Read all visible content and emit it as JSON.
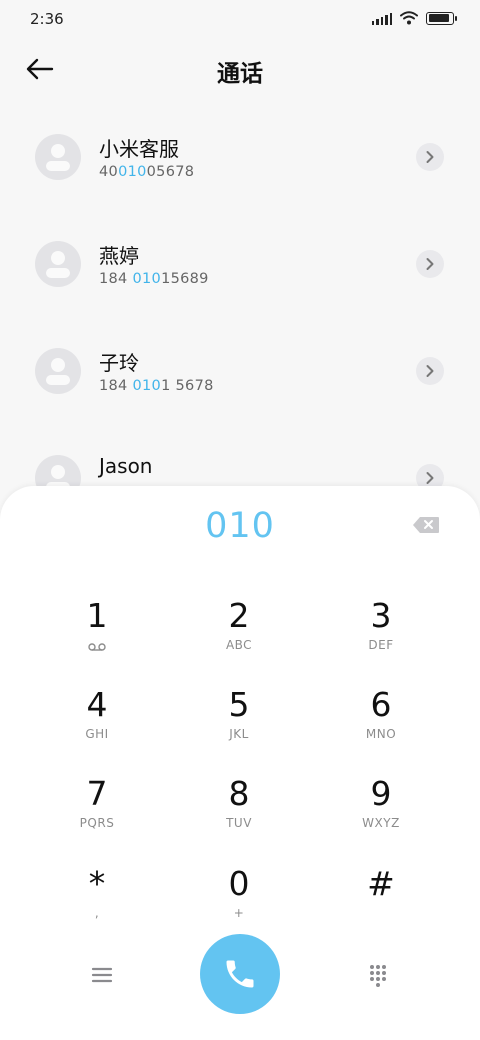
{
  "status_bar": {
    "time": "2:36",
    "battery_level": 0.9,
    "icons": [
      "signal-icon",
      "wifi-icon",
      "battery-icon"
    ]
  },
  "header": {
    "title": "通话",
    "back_icon": "arrow-left-icon"
  },
  "contacts": [
    {
      "name": "小米客服",
      "number_before": "40",
      "number_match": "010",
      "number_after": "05678"
    },
    {
      "name": "燕婷",
      "number_before": "184 ",
      "number_match": "010",
      "number_after": "15689"
    },
    {
      "name": "子玲",
      "number_before": "184 ",
      "number_match": "010",
      "number_after": "1 5678"
    },
    {
      "name": "Jason",
      "number_before": "",
      "number_match": "",
      "number_after": ""
    }
  ],
  "dialpad": {
    "input": "010",
    "backspace_icon": "backspace-icon",
    "keys": [
      {
        "digit": "1",
        "letters": "",
        "icon": "voicemail-icon"
      },
      {
        "digit": "2",
        "letters": "ABC"
      },
      {
        "digit": "3",
        "letters": "DEF"
      },
      {
        "digit": "4",
        "letters": "GHI"
      },
      {
        "digit": "5",
        "letters": "JKL"
      },
      {
        "digit": "6",
        "letters": "MNO"
      },
      {
        "digit": "7",
        "letters": "PQRS"
      },
      {
        "digit": "8",
        "letters": "TUV"
      },
      {
        "digit": "9",
        "letters": "WXYZ"
      },
      {
        "digit": "*",
        "letters": ","
      },
      {
        "digit": "0",
        "letters": "+"
      },
      {
        "digit": "#",
        "letters": ""
      }
    ],
    "call_icon": "phone-icon",
    "menu_icon": "menu-icon",
    "keypad_icon": "dialpad-icon"
  },
  "colors": {
    "accent": "#63c4f1",
    "highlight": "#41b4ea",
    "background": "#f7f7f7",
    "dialpad_bg": "#ffffff"
  }
}
